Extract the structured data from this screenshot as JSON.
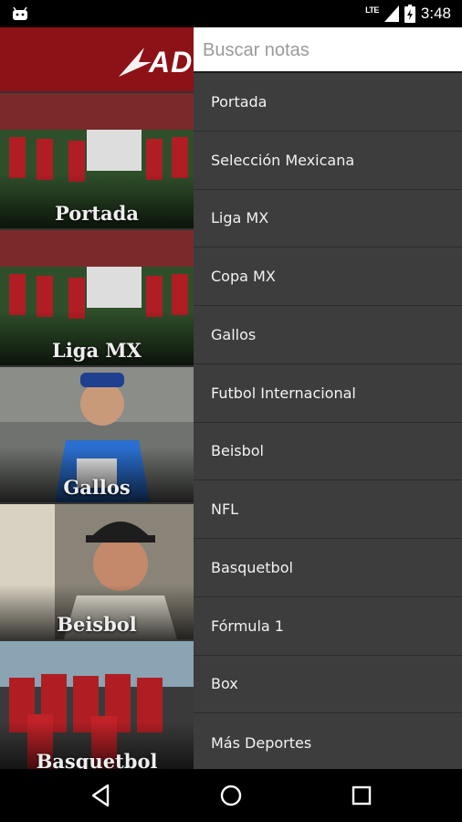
{
  "status_bar": {
    "network": "LTE",
    "time": "3:48",
    "icons": [
      "android-icon",
      "lte-signal-icon",
      "battery-icon"
    ]
  },
  "app": {
    "logo_text": "ADR",
    "brand_color": "#8c1218",
    "tiles": [
      {
        "label": "Portada"
      },
      {
        "label": "Liga MX"
      },
      {
        "label": "Gallos"
      },
      {
        "label": "Beisbol"
      },
      {
        "label": "Basquetbol"
      }
    ]
  },
  "drawer": {
    "search_placeholder": "Buscar notas",
    "items": [
      {
        "label": "Portada"
      },
      {
        "label": "Selección Mexicana"
      },
      {
        "label": "Liga MX"
      },
      {
        "label": "Copa MX"
      },
      {
        "label": "Gallos"
      },
      {
        "label": "Futbol Internacional"
      },
      {
        "label": "Beisbol"
      },
      {
        "label": "NFL"
      },
      {
        "label": "Basquetbol"
      },
      {
        "label": "Fórmula 1"
      },
      {
        "label": "Box"
      },
      {
        "label": "Más Deportes"
      }
    ]
  },
  "nav_bar": {
    "icons": [
      "back-icon",
      "home-icon",
      "recents-icon"
    ]
  }
}
